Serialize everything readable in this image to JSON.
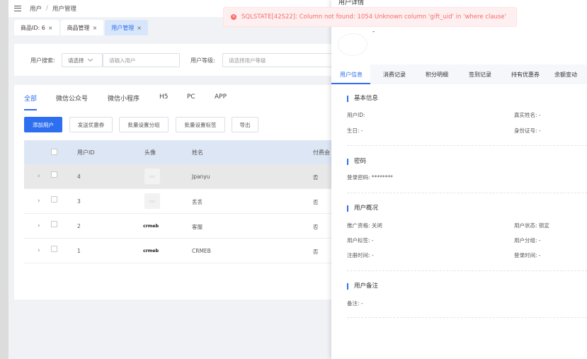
{
  "breadcrumb": {
    "root": "用户",
    "separator": "/",
    "current": "用户管理"
  },
  "page_tabs": [
    {
      "label": "商品ID: 6",
      "close": "×"
    },
    {
      "label": "商品管理",
      "close": "×"
    },
    {
      "label": "用户管理",
      "close": "×",
      "active": true
    }
  ],
  "filter": {
    "search_label": "用户搜索:",
    "search_select": "请选择",
    "search_placeholder": "请输入用户",
    "level_label": "用户等级:",
    "level_placeholder": "请选择用户等级"
  },
  "source_tabs": [
    "全部",
    "微信公众号",
    "微信小程序",
    "H5",
    "PC",
    "APP"
  ],
  "actions": {
    "add": "添加用户",
    "coupon": "发送优惠券",
    "group": "批量设置分组",
    "tag": "批量设置标签",
    "export": "导出"
  },
  "table": {
    "headers": {
      "id": "用户ID",
      "avatar": "头像",
      "name": "姓名",
      "paid": "付费会"
    },
    "rows": [
      {
        "id": "4",
        "avatar": "placeholder",
        "name": "Jpanyu",
        "paid": "否"
      },
      {
        "id": "3",
        "avatar": "placeholder",
        "name": "丢丢",
        "paid": "否"
      },
      {
        "id": "2",
        "avatar": "crmeb-logo",
        "logo_text": "crmeb",
        "name": "客服",
        "paid": "否"
      },
      {
        "id": "1",
        "avatar": "crmeb-logo",
        "logo_text": "crmeb",
        "name": "CRMEB",
        "paid": "否"
      }
    ],
    "expand_glyph": "›"
  },
  "drawer": {
    "title": "用户详情",
    "dash": "-",
    "tabs": [
      "用户信息",
      "消费记录",
      "积分明细",
      "签到记录",
      "持有优惠券",
      "余额变动"
    ],
    "sections": {
      "basic": {
        "title": "基本信息",
        "uid": "用户ID:",
        "real_name": "真实姓名: -",
        "birthday": "生日: -",
        "id_card": "身份证号: -"
      },
      "password": {
        "title": "密码",
        "login_pwd": "登录密码: ********"
      },
      "overview": {
        "title": "用户概况",
        "promoter": "推广资格: 关闭",
        "status": "用户状态: 锁定",
        "tag": "用户标签: -",
        "group": "用户分组: -",
        "register_time": "注册时间: -",
        "login_time": "登录时间: -"
      },
      "remark": {
        "title": "用户备注",
        "remark": "备注: -"
      }
    }
  },
  "toast": {
    "icon": "×",
    "message": "SQLSTATE[42S22]: Column not found: 1054 Unknown column 'gift_uid' in 'where clause'"
  },
  "colors": {
    "accent": "#2d6ff0",
    "error": "#f56c6c"
  }
}
